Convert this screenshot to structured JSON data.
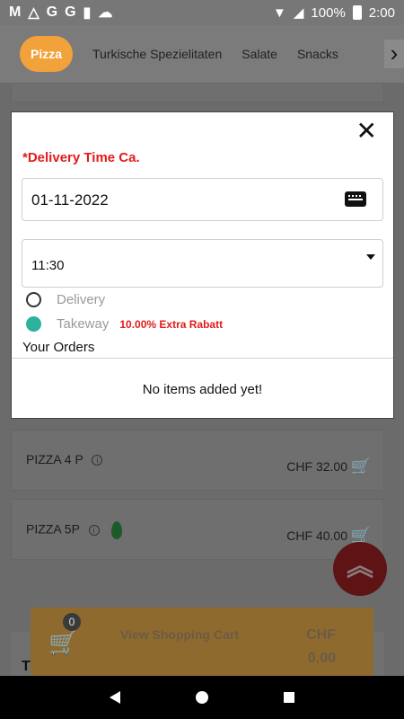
{
  "status_bar": {
    "left_icons": [
      "gmail-icon",
      "drive-icon",
      "google-icon",
      "google-icon",
      "sd-card-icon",
      "cloud-icon"
    ],
    "battery": "100%",
    "time": "2:00"
  },
  "categories": {
    "items": [
      "Pizza",
      "Turkische Spezielitaten",
      "Salate",
      "Snacks"
    ],
    "active": "Pizza"
  },
  "menu_items": [
    {
      "name": "PIZZA 4 P",
      "price": "CHF 32.00"
    },
    {
      "name": "PIZZA 5P",
      "price": "CHF 40.00"
    }
  ],
  "cart": {
    "count": "0",
    "label": "View Shopping Cart",
    "currency": "CHF",
    "total": "0.00"
  },
  "background_partial_text": "T",
  "modal": {
    "close_glyph": "✕",
    "title": "*Delivery Time Ca.",
    "date_value": "01-11-2022",
    "time_value": "11:30",
    "options": {
      "delivery": "Delivery",
      "takeway": "Takeway",
      "takeway_discount": "10.00% Extra Rabatt",
      "selected": "Takeway"
    },
    "orders_title": "Your Orders",
    "orders_empty": "No items added yet!"
  },
  "colors": {
    "accent": "#f1a23a",
    "error": "#e21b1b",
    "radio_selected": "#2bb39e",
    "brand_dark": "#5e1414"
  }
}
